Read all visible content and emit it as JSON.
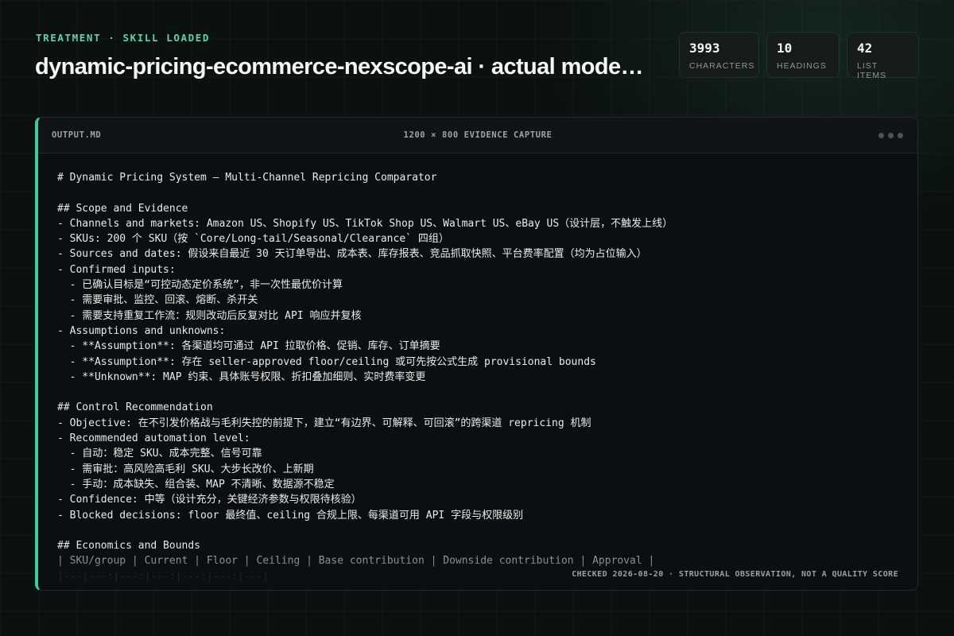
{
  "header": {
    "eyebrow": "TREATMENT · SKILL LOADED",
    "title": "dynamic-pricing-ecommerce-nexscope-ai · actual model output"
  },
  "stats": [
    {
      "value": "3993",
      "label": "CHARACTERS"
    },
    {
      "value": "10",
      "label": "HEADINGS"
    },
    {
      "value": "42",
      "label": "LIST ITEMS"
    }
  ],
  "panel": {
    "filename": "OUTPUT.MD",
    "caption": "1200 × 800 EVIDENCE CAPTURE",
    "footer": "CHECKED 2026-08-20 · STRUCTURAL OBSERVATION, NOT A QUALITY SCORE",
    "lines": [
      "# Dynamic Pricing System — Multi-Channel Repricing Comparator",
      "",
      "## Scope and Evidence",
      "- Channels and markets: Amazon US、Shopify US、TikTok Shop US、Walmart US、eBay US（设计层，不触发上线）",
      "- SKUs: 200 个 SKU（按 `Core/Long-tail/Seasonal/Clearance` 四组）",
      "- Sources and dates: 假设来自最近 30 天订单导出、成本表、库存报表、竞品抓取快照、平台费率配置（均为占位输入）",
      "- Confirmed inputs:",
      "  - 已确认目标是“可控动态定价系统”，非一次性最优价计算",
      "  - 需要审批、监控、回滚、熔断、杀开关",
      "  - 需要支持重复工作流：规则改动后反复对比 API 响应并复核",
      "- Assumptions and unknowns:",
      "  - **Assumption**: 各渠道均可通过 API 拉取价格、促销、库存、订单摘要",
      "  - **Assumption**: 存在 seller-approved floor/ceiling 或可先按公式生成 provisional bounds",
      "  - **Unknown**: MAP 约束、具体账号权限、折扣叠加细则、实时费率变更",
      "",
      "## Control Recommendation",
      "- Objective: 在不引发价格战与毛利失控的前提下，建立“有边界、可解释、可回滚”的跨渠道 repricing 机制",
      "- Recommended automation level:",
      "  - 自动：稳定 SKU、成本完整、信号可靠",
      "  - 需审批：高风险高毛利 SKU、大步长改价、上新期",
      "  - 手动：成本缺失、组合装、MAP 不清晰、数据源不稳定",
      "- Confidence: 中等（设计充分，关键经济参数与权限待核验）",
      "- Blocked decisions: floor 最终值、ceiling 合规上限、每渠道可用 API 字段与权限级别",
      "",
      "## Economics and Bounds",
      "| SKU/group | Current | Floor | Ceiling | Base contribution | Downside contribution | Approval |",
      "|---|---:|---:|---:|---:|---:|---|"
    ]
  }
}
